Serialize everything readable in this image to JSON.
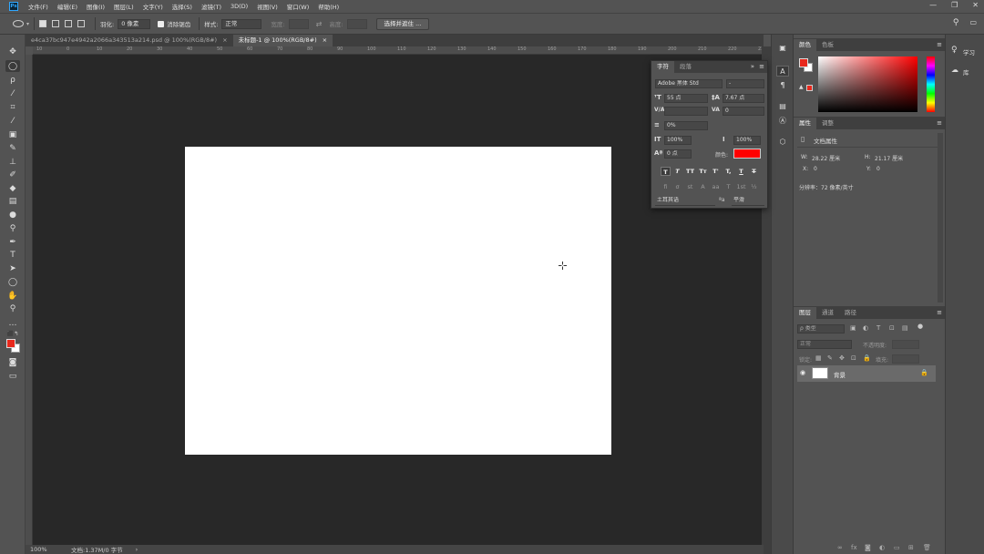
{
  "app": {
    "logo": "Ps"
  },
  "menu": {
    "items": [
      "文件(F)",
      "编辑(E)",
      "图像(I)",
      "图层(L)",
      "文字(Y)",
      "选择(S)",
      "滤镜(T)",
      "3D(D)",
      "视图(V)",
      "窗口(W)",
      "帮助(H)"
    ]
  },
  "window_controls": {
    "minimize": "—",
    "restore": "❐",
    "close": "✕"
  },
  "options": {
    "feather_label": "羽化:",
    "feather_value": "0 像素",
    "antialias_label": "消除锯齿",
    "style_label": "样式:",
    "style_value": "正常",
    "width_label": "宽度:",
    "height_label": "高度:",
    "select_mask_button": "选择并遮住 ..."
  },
  "tabs": [
    {
      "label": "e4ca37bc947e4942a2066a343513a214.psd @ 100%(RGB/8#)",
      "close": "×"
    },
    {
      "label": "未标题-1 @ 100%(RGB/8#)",
      "close": "×"
    }
  ],
  "rulers": {
    "top": [
      "10",
      "0",
      "10",
      "20",
      "30",
      "40",
      "50",
      "60",
      "70",
      "80",
      "90",
      "100",
      "110",
      "120",
      "130",
      "140",
      "150",
      "160",
      "170",
      "180",
      "190",
      "200",
      "210",
      "220",
      "230"
    ]
  },
  "status": {
    "zoom": "100%",
    "doc": "文档:1.37M/0 字节",
    "arrow": "›"
  },
  "character_panel": {
    "tab_character": "字符",
    "tab_paragraph": "段落",
    "menu_icon": "≡",
    "collapse_icon": "»",
    "font_family": "Adobe 黑体 Std",
    "font_style": "-",
    "font_size": "55 点",
    "leading": "7.67 点",
    "kerning": "",
    "tracking": "0",
    "vertical_scale_pct": "0%",
    "vertical_scale": "100%",
    "horizontal_scale": "100%",
    "baseline_shift": "0 点",
    "color_label": "颜色:",
    "color": "#ff0000",
    "language": "土耳其语",
    "antialias": "平滑",
    "aa_icon": "ªa"
  },
  "color_panel": {
    "tab_color": "颜色",
    "tab_swatches": "色板",
    "foreground": "#e8281c",
    "background": "#ffffff",
    "menu_icon": "≡"
  },
  "properties_panel": {
    "tab_properties": "属性",
    "tab_adjustments": "调整",
    "section_title": "文档属性",
    "w_label": "W:",
    "w_value": "28.22 厘米",
    "h_label": "H:",
    "h_value": "21.17 厘米",
    "x_label": "X:",
    "x_value": "0",
    "y_label": "Y:",
    "y_value": "0",
    "resolution": "分辨率：72 像素/英寸",
    "menu_icon": "≡"
  },
  "layers_panel": {
    "tab_layers": "图层",
    "tab_channels": "通道",
    "tab_paths": "路径",
    "filter_placeholder": "ρ 类型",
    "blend_mode": "正常",
    "opacity_label": "不透明度:",
    "lock_label": "锁定:",
    "fill_label": "填充:",
    "layer_name": "背景",
    "menu_icon": "≡",
    "bottom_icons": [
      "∞",
      "fx",
      "◙",
      "◐",
      "▭",
      "⊞",
      "🗑"
    ]
  },
  "learn": {
    "label": "学习"
  }
}
